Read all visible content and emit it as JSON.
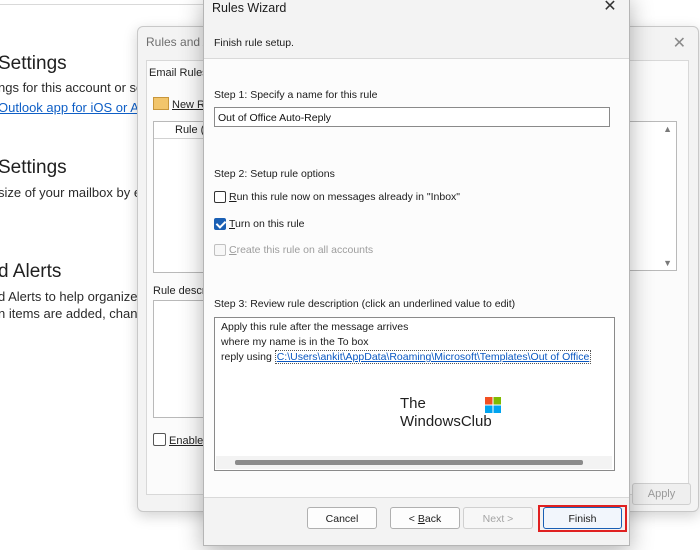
{
  "background": {
    "sections": [
      {
        "heading": "Settings",
        "line1": "ngs for this account or set",
        "line2_link": "Outlook app for iOS or An"
      },
      {
        "heading": "Settings",
        "line1": "size of your mailbox by en"
      },
      {
        "heading": "d Alerts",
        "line1": "d Alerts to help organize",
        "line2": "n items are added, chang"
      }
    ]
  },
  "rules_alerts": {
    "title": "Rules and A",
    "close_icon": "✕",
    "tab_label": "Email Rules",
    "new_rule": "New R",
    "list_header": "Rule (",
    "description_label": "Rule descr",
    "enable_label": "Enable",
    "apply_label": "Apply"
  },
  "wizard": {
    "title": "Rules Wizard",
    "close_icon": "✕",
    "subtitle": "Finish rule setup.",
    "step1_label": "Step 1: Specify a name for this rule",
    "rule_name_value": "Out of Office Auto-Reply",
    "step2_label": "Step 2: Setup rule options",
    "options": [
      {
        "label_prefix": "R",
        "label_rest": "un this rule now on messages already in \"Inbox\"",
        "checked": false,
        "disabled": false
      },
      {
        "label_prefix": "T",
        "label_rest": "urn on this rule",
        "checked": true,
        "disabled": false
      },
      {
        "label_prefix": "C",
        "label_rest": "reate this rule on all accounts",
        "checked": false,
        "disabled": true
      }
    ],
    "step3_label": "Step 3: Review rule description (click an underlined value to edit)",
    "description": {
      "line1": "Apply this rule after the message arrives",
      "line2": "where my name is in the To box",
      "line3_prefix": "reply using ",
      "line3_link": "C:\\Users\\ankit\\AppData\\Roaming\\Microsoft\\Templates\\Out of Office"
    },
    "watermark": {
      "line1": "The",
      "line2": "WindowsClub"
    },
    "buttons": {
      "cancel": "Cancel",
      "back_prefix": "< ",
      "back_underline": "B",
      "back_rest": "ack",
      "next": "Next >",
      "finish": "Finish"
    },
    "colors": {
      "accent": "#1a5fb4",
      "highlight": "#e02020",
      "link": "#0a58c2"
    }
  }
}
